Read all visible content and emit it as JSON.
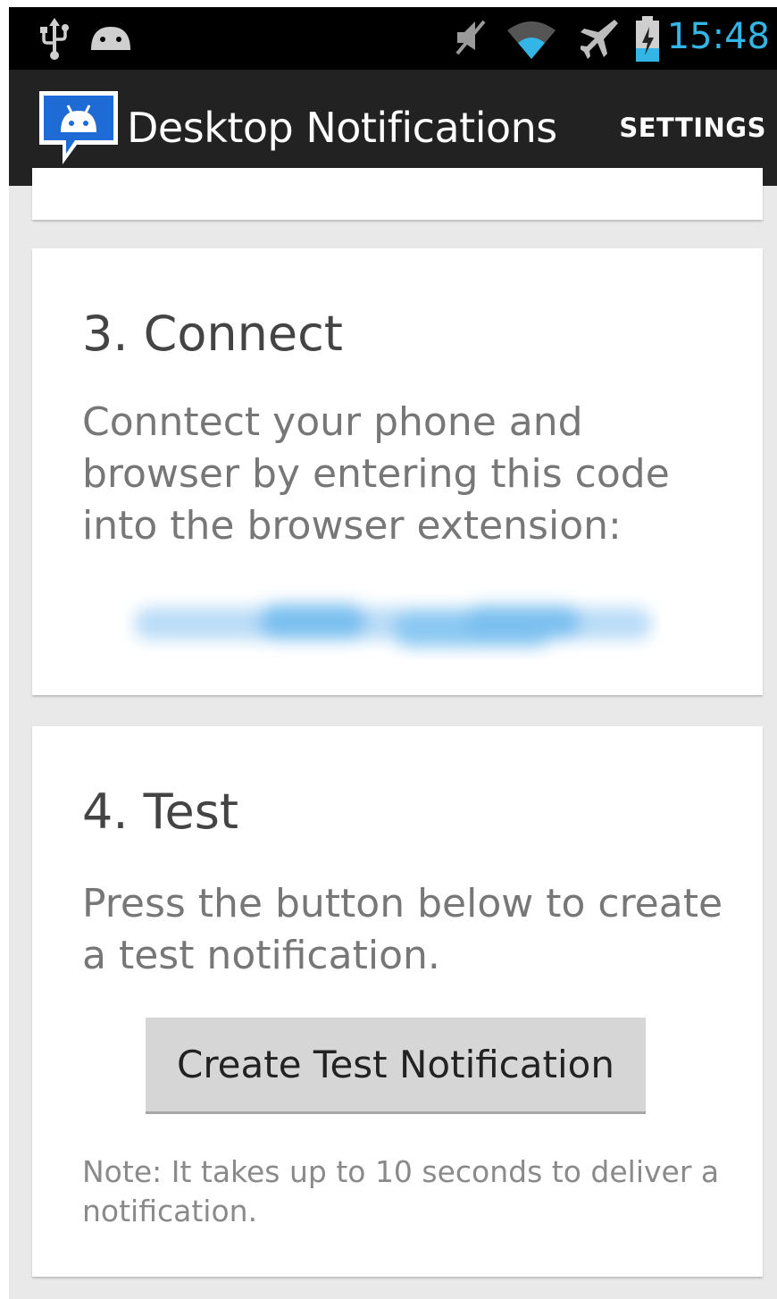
{
  "status_bar": {
    "time": "15:48",
    "icons": [
      "usb-icon",
      "android-debug-icon",
      "mute-icon",
      "wifi-icon",
      "airplane-icon",
      "battery-charging-icon"
    ]
  },
  "action_bar": {
    "title": "Desktop Notifications",
    "settings_label": "SETTINGS",
    "accent": "#33b5e5"
  },
  "connect": {
    "heading": "3. Connect",
    "body": "Conntect your phone and browser by entering this code into the browser extension:"
  },
  "test": {
    "heading": "4. Test",
    "body": "Press the button below to create a test notification.",
    "button_label": "Create Test Notification",
    "note": "Note: It takes up to 10 seconds to deliver a notification."
  }
}
